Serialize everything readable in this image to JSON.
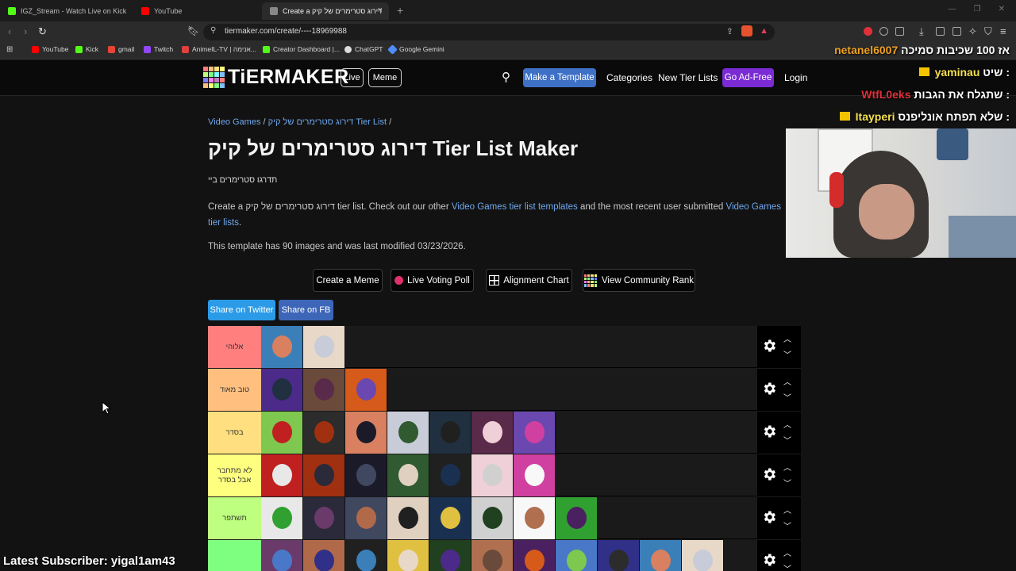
{
  "browser": {
    "tabs": [
      {
        "label": "IGZ_Stream - Watch Live on Kick",
        "color": "#53fc18"
      },
      {
        "label": "YouTube",
        "color": "#ff0000"
      },
      {
        "label": "Create a דירוג סטרימרים של קיק",
        "color": "#888888"
      }
    ],
    "url": "tiermaker.com/create/----18969988",
    "bookmarks": [
      {
        "label": "YouTube",
        "color": "#ff0000"
      },
      {
        "label": "Kick",
        "color": "#53fc18"
      },
      {
        "label": "gmail",
        "color": "#ea4335"
      },
      {
        "label": "Twitch",
        "color": "#9146ff"
      },
      {
        "label": "AnimeIL-TV | אנימה...",
        "color": "#e04040"
      },
      {
        "label": "Creator Dashboard |...",
        "color": "#53fc18"
      },
      {
        "label": "ChatGPT",
        "color": "#dddddd"
      },
      {
        "label": "Google Gemini",
        "color": "#4f8df7"
      }
    ]
  },
  "site": {
    "logo": "TiERMAKER",
    "live": "Live",
    "meme": "Meme",
    "make_template": "Make a Template",
    "categories": "Categories",
    "new_tier_lists": "New Tier Lists",
    "ad_free": "Go Ad-Free",
    "login": "Login"
  },
  "page": {
    "crumb_category": "Video Games",
    "crumb_sep": "/",
    "crumb_item": "דירוג סטרימרים של קיק Tier List",
    "crumb_tail": "/",
    "title": "דירוג סטרימרים של קיק Tier List Maker",
    "subtitle": "תדרגו סטרימרים ביי",
    "desc_1": "Create a דירוג סטרימרים של קיק tier list. Check out our other",
    "desc_link_1": "Video Games tier list templates",
    "desc_2": "and the most recent user submitted",
    "desc_link_2": "Video Games tier lists",
    "desc_end": ".",
    "modified": "This template has 90 images and was last modified 03/23/2026.",
    "btn_meme": "Create a Meme",
    "btn_poll": "Live Voting Poll",
    "btn_alignment": "Alignment Chart",
    "btn_community": "View Community Rank",
    "share_twitter": "Share on Twitter",
    "share_fb": "Share on FB"
  },
  "tiers": [
    {
      "label": "אלוהי",
      "color": "#ff7f7f",
      "count": 2
    },
    {
      "label": "טוב מאוד",
      "color": "#ffbf7f",
      "count": 3
    },
    {
      "label": "בסדר",
      "color": "#ffdf7f",
      "count": 7
    },
    {
      "label": "לא מתחבר אבל בסדר",
      "color": "#ffff7f",
      "count": 7
    },
    {
      "label": "תשתפר",
      "color": "#bfff7f",
      "count": 8
    },
    {
      "label": "",
      "color": "#7fff7f",
      "count": 11
    }
  ],
  "overlay": {
    "chat": [
      {
        "user": "netanel6007",
        "msg": "אז 100 שכיבות סמיכה",
        "color": "#f0a020"
      },
      {
        "user": "yaminau",
        "msg": "שיט :",
        "color": "#f5e050"
      },
      {
        "user": "WtfL0eks",
        "msg": "שתגלח את הגבות :",
        "color": "#e0303a"
      },
      {
        "user": "Itayperi",
        "msg": "שלא תפתח אונליפנס :",
        "color": "#f5e050"
      }
    ],
    "latest_subscriber": "Latest Subscriber: yigal1am43"
  }
}
